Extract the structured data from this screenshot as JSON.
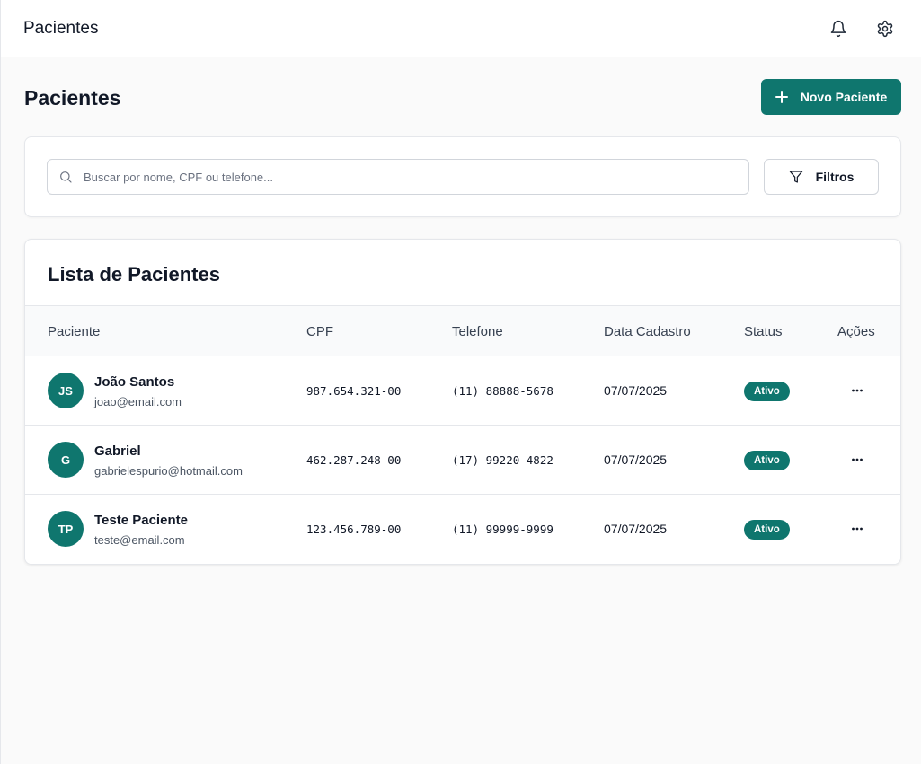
{
  "topbar": {
    "title": "Pacientes",
    "icons": [
      "bell-icon",
      "gear-icon"
    ]
  },
  "page": {
    "title": "Pacientes",
    "new_button_label": "Novo Paciente",
    "new_button_icon": "plus-icon"
  },
  "search": {
    "placeholder": "Buscar por nome, CPF ou telefone...",
    "value": "",
    "icon": "search-icon",
    "filter_label": "Filtros",
    "filter_icon": "funnel-icon"
  },
  "list": {
    "title": "Lista de Pacientes",
    "columns": {
      "patient": "Paciente",
      "cpf": "CPF",
      "phone": "Telefone",
      "date": "Data Cadastro",
      "status": "Status",
      "actions": "Ações"
    },
    "rows": [
      {
        "initials": "JS",
        "name": "João Santos",
        "email": "joao@email.com",
        "cpf": "987.654.321-00",
        "phone": "(11) 88888-5678",
        "date": "07/07/2025",
        "status": "Ativo"
      },
      {
        "initials": "G",
        "name": "Gabriel",
        "email": "gabrielespurio@hotmail.com",
        "cpf": "462.287.248-00",
        "phone": "(17) 99220-4822",
        "date": "07/07/2025",
        "status": "Ativo"
      },
      {
        "initials": "TP",
        "name": "Teste Paciente",
        "email": "teste@email.com",
        "cpf": "123.456.789-00",
        "phone": "(11) 99999-9999",
        "date": "07/07/2025",
        "status": "Ativo"
      }
    ]
  },
  "colors": {
    "primary": "#0f766e",
    "background": "#fafafa",
    "border": "#e5e7eb"
  }
}
